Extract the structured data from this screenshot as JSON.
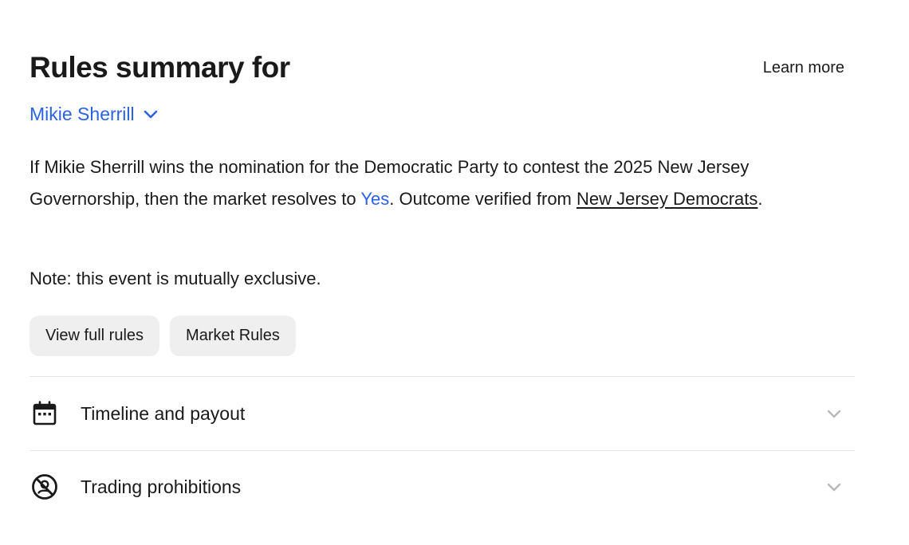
{
  "header": {
    "title": "Rules summary for",
    "learn_more": "Learn more"
  },
  "selector": {
    "value": "Mikie Sherrill"
  },
  "description": {
    "prefix": "If Mikie Sherrill wins the nomination for the Democratic Party to contest the 2025 New Jersey Governorship, then the market resolves to ",
    "outcome": "Yes",
    "middle": ". Outcome verified from ",
    "source": "New Jersey Democrats",
    "suffix": "."
  },
  "note": "Note: this event is mutually exclusive.",
  "buttons": {
    "view_full_rules": "View full rules",
    "market_rules": "Market Rules"
  },
  "sections": [
    {
      "label": "Timeline and payout",
      "icon": "calendar-icon"
    },
    {
      "label": "Trading prohibitions",
      "icon": "prohibited-icon"
    }
  ],
  "colors": {
    "accent": "#2a62e3",
    "text": "#1a1a1a",
    "button_bg": "#efefef",
    "divider": "#e6e6e6",
    "chevron_muted": "#b8b8b8"
  }
}
